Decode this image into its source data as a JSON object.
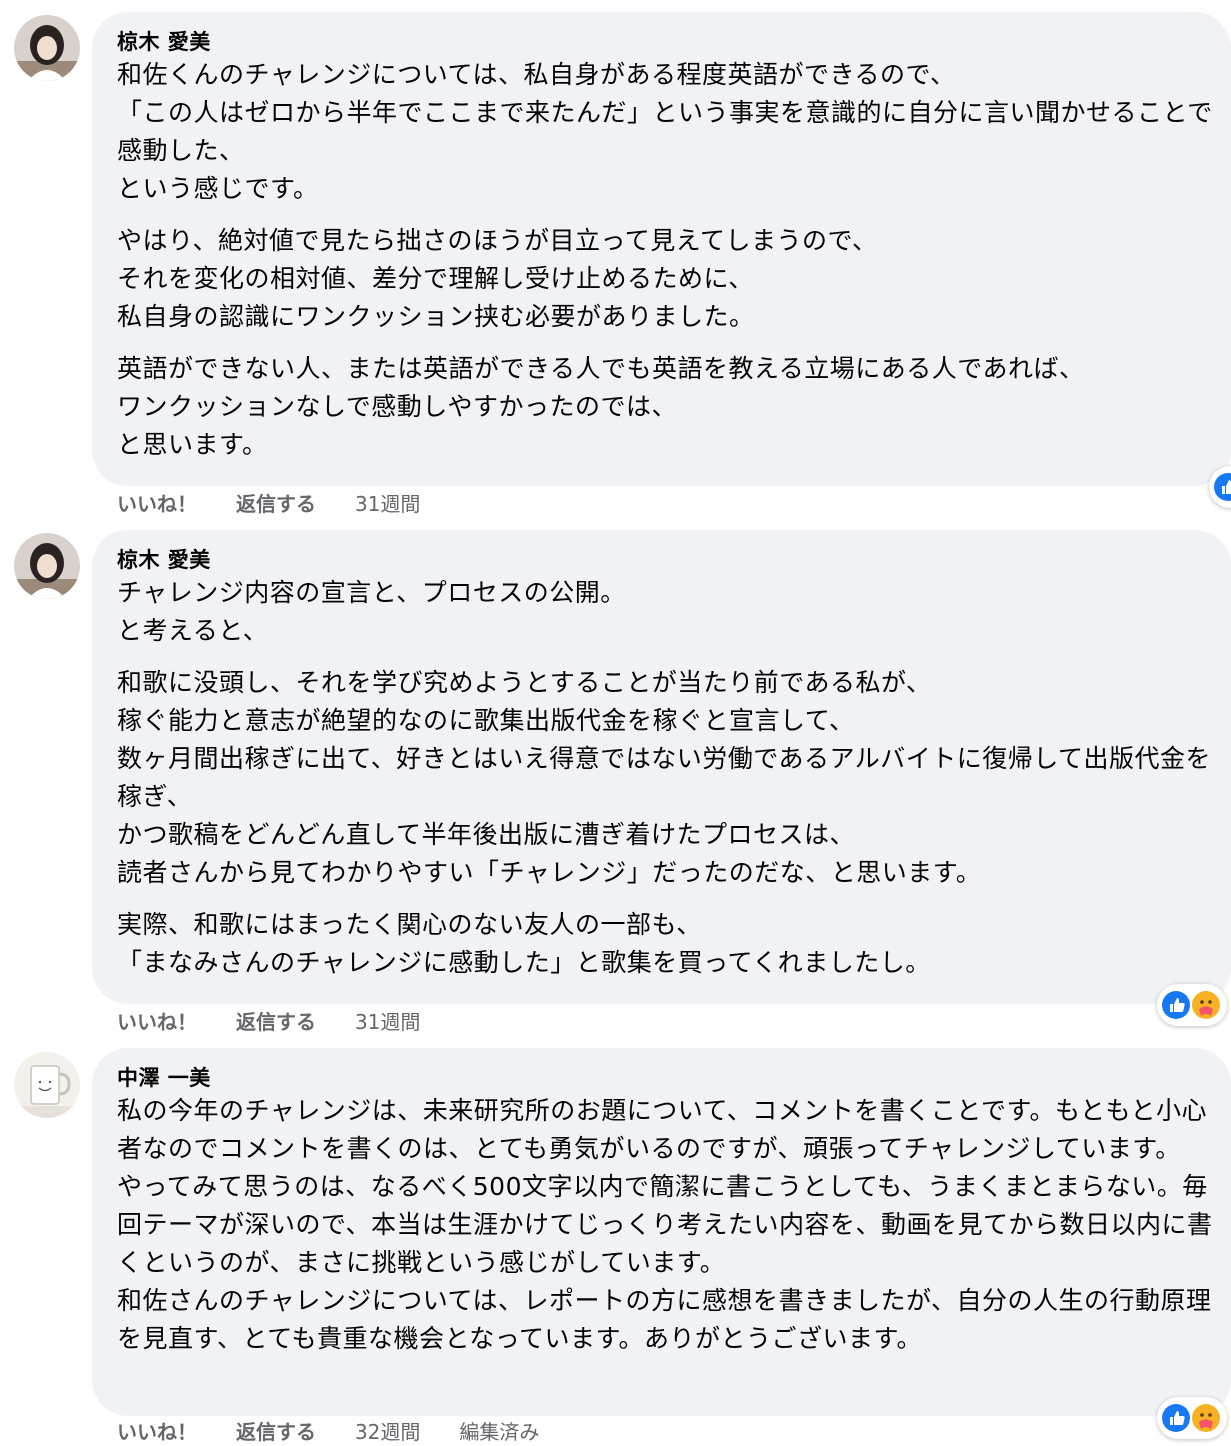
{
  "comments": [
    {
      "author": "椋木 愛美",
      "paragraphs": [
        "和佐くんのチャレンジについては、私自身がある程度英語ができるので、\n「この人はゼロから半年でここまで来たんだ」という事実を意識的に自分に言い聞かせることで感動した、\nという感じです。",
        "やはり、絶対値で見たら拙さのほうが目立って見えてしまうので、\nそれを変化の相対値、差分で理解し受け止めるために、\n私自身の認識にワンクッション挟む必要がありました。",
        "英語ができない人、または英語ができる人でも英語を教える立場にある人であれば、\nワンクッションなしで感動しやすかったのでは、\nと思います。"
      ],
      "like_label": "いいね！",
      "reply_label": "返信する",
      "time": "31週間",
      "reactions": [
        "like-icon"
      ]
    },
    {
      "author": "椋木 愛美",
      "paragraphs": [
        "チャレンジ内容の宣言と、プロセスの公開。\nと考えると、",
        "和歌に没頭し、それを学び究めようとすることが当たり前である私が、\n稼ぐ能力と意志が絶望的なのに歌集出版代金を稼ぐと宣言して、\n数ヶ月間出稼ぎに出て、好きとはいえ得意ではない労働であるアルバイトに復帰して出版代金を稼ぎ、\nかつ歌稿をどんどん直して半年後出版に漕ぎ着けたプロセスは、\n読者さんから見てわかりやすい「チャレンジ」だったのだな、と思います。",
        "実際、和歌にはまったく関心のない友人の一部も、\n「まなみさんのチャレンジに感動した」と歌集を買ってくれましたし。"
      ],
      "like_label": "いいね！",
      "reply_label": "返信する",
      "time": "31週間",
      "reactions": [
        "like-icon",
        "care-icon"
      ]
    },
    {
      "author": "中澤 一美",
      "paragraphs": [
        "私の今年のチャレンジは、未来研究所のお題について、コメントを書くことです。もともと小心者なのでコメントを書くのは、とても勇気がいるのですが、頑張ってチャレンジしています。\nやってみて思うのは、なるべく500文字以内で簡潔に書こうとしても、うまくまとまらない。毎回テーマが深いので、本当は生涯かけてじっくり考えたい内容を、動画を見てから数日以内に書くというのが、まさに挑戦という感じがしています。\n和佐さんのチャレンジについては、レポートの方に感想を書きましたが、自分の人生の行動原理を見直す、とても貴重な機会となっています。ありがとうございます。"
      ],
      "like_label": "いいね！",
      "reply_label": "返信する",
      "time": "32週間",
      "edited_label": "編集済み",
      "reactions": [
        "like-icon",
        "care-icon"
      ]
    }
  ],
  "colors": {
    "bubble": "#f0f2f5",
    "meta_text": "#65676b",
    "like_blue": "#1877f2",
    "care_yellow": "#f7b125"
  }
}
